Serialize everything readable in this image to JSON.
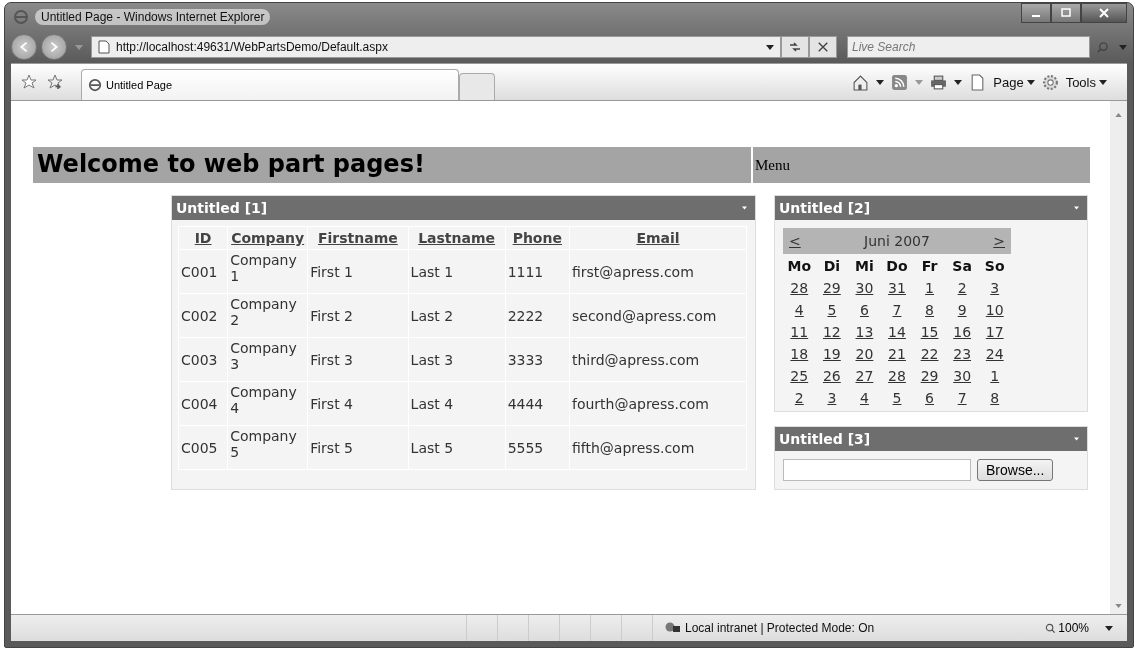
{
  "window": {
    "title": "Untitled Page - Windows Internet Explorer"
  },
  "address_bar": {
    "url": "http://localhost:49631/WebPartsDemo/Default.aspx",
    "search_placeholder": "Live Search"
  },
  "tabs": [
    {
      "label": "Untitled Page",
      "selected": true
    }
  ],
  "command_bar": {
    "items": [
      "Page",
      "Tools"
    ]
  },
  "page": {
    "heading": "Welcome to web part pages!",
    "menu_label": "Menu",
    "grid_part": {
      "title": "Untitled [1]",
      "columns": [
        "ID",
        "Company",
        "Firstname",
        "Lastname",
        "Phone",
        "Email"
      ],
      "rows": [
        [
          "C001",
          "Company 1",
          "First 1",
          "Last 1",
          "1111",
          "first@apress.com"
        ],
        [
          "C002",
          "Company 2",
          "First 2",
          "Last 2",
          "2222",
          "second@apress.com"
        ],
        [
          "C003",
          "Company 3",
          "First 3",
          "Last 3",
          "3333",
          "third@apress.com"
        ],
        [
          "C004",
          "Company 4",
          "First 4",
          "Last 4",
          "4444",
          "fourth@apress.com"
        ],
        [
          "C005",
          "Company 5",
          "First 5",
          "Last 5",
          "5555",
          "fifth@apress.com"
        ]
      ]
    },
    "calendar_part": {
      "title": "Untitled [2]",
      "prev": "<",
      "next": ">",
      "month": "Juni 2007",
      "weekdays": [
        "Mo",
        "Di",
        "Mi",
        "Do",
        "Fr",
        "Sa",
        "So"
      ],
      "weeks": [
        [
          "28",
          "29",
          "30",
          "31",
          "1",
          "2",
          "3"
        ],
        [
          "4",
          "5",
          "6",
          "7",
          "8",
          "9",
          "10"
        ],
        [
          "11",
          "12",
          "13",
          "14",
          "15",
          "16",
          "17"
        ],
        [
          "18",
          "19",
          "20",
          "21",
          "22",
          "23",
          "24"
        ],
        [
          "25",
          "26",
          "27",
          "28",
          "29",
          "30",
          "1"
        ],
        [
          "2",
          "3",
          "4",
          "5",
          "6",
          "7",
          "8"
        ]
      ]
    },
    "upload_part": {
      "title": "Untitled [3]",
      "button": "Browse..."
    }
  },
  "status_bar": {
    "zone": "Local intranet | Protected Mode: On",
    "zoom": "100%"
  }
}
